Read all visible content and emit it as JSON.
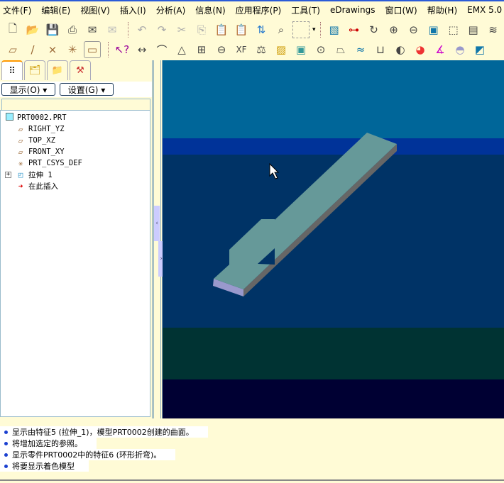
{
  "menu": [
    "文件(F)",
    "编辑(E)",
    "视图(V)",
    "插入(I)",
    "分析(A)",
    "信息(N)",
    "应用程序(P)",
    "工具(T)",
    "eDrawings",
    "窗口(W)",
    "帮助(H)",
    "EMX 5.0"
  ],
  "panel": {
    "show_label": "显示(O) ▾",
    "settings_label": "设置(G) ▾"
  },
  "tree": {
    "root": "PRT0002.PRT",
    "items": [
      {
        "label": "RIGHT_YZ",
        "icon": "datum-plane-icon"
      },
      {
        "label": "TOP_XZ",
        "icon": "datum-plane-icon"
      },
      {
        "label": "FRONT_XY",
        "icon": "datum-plane-icon"
      },
      {
        "label": "PRT_CSYS_DEF",
        "icon": "csys-icon"
      },
      {
        "label": "拉伸 1",
        "icon": "extrude-icon"
      },
      {
        "label": "在此插入",
        "icon": "insert-here-arrow-icon"
      }
    ]
  },
  "messages": [
    "显示由特征5 (拉伸_1)，模型PRT0002创建的曲面。",
    "将增加选定的参照。",
    "显示零件PRT0002中的特征6 (环形折弯)。",
    "将要显示着色模型"
  ],
  "colors": {
    "viewport_top": "#006699",
    "viewport_band": "#003399",
    "viewport_main": "#003366",
    "viewport_lower": "#003333",
    "viewport_bottom": "#000033",
    "model_top": "#669999",
    "model_side": "#666666",
    "model_front": "#9999cc"
  }
}
